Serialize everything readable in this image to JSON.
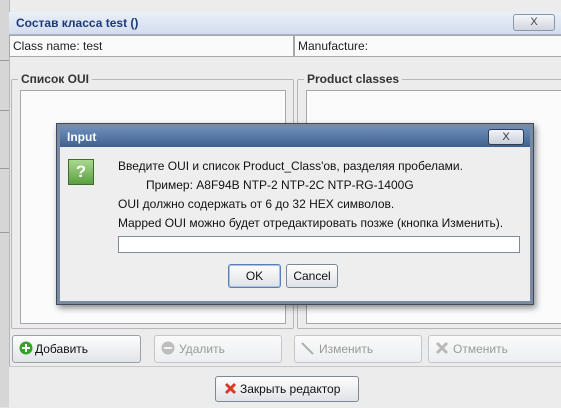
{
  "window": {
    "title": "Состав класса test ()",
    "close_glyph": "X",
    "class_name_label": "Class name: test",
    "manufacture_label": "Manufacture:"
  },
  "groups": {
    "oui_list": "Список OUI",
    "product_classes": "Product classes"
  },
  "toolbar": {
    "add": "Добавить",
    "delete": "Удалить",
    "edit": "Изменить",
    "cancel": "Отменить"
  },
  "footer": {
    "close_editor": "Закрыть редактор"
  },
  "dialog": {
    "title": "Input",
    "close_glyph": "X",
    "line1": "Введите OUI и список Product_Class'ов, разделяя пробелами.",
    "line2": "Пример: A8F94B NTP-2 NTP-2C NTP-RG-1400G",
    "line3": "OUI должно содержать от 6 до 32 HEX символов.",
    "line4": "Mapped OUI можно будет отредактировать позже (кнопка Изменить).",
    "input_value": "",
    "ok": "OK",
    "cancel": "Cancel"
  },
  "colors": {
    "title_text": "#1c3a7a",
    "dialog_title_bg": "#4f6f9f",
    "add_icon": "#3aa02c",
    "close_icon": "#d83a2a"
  },
  "icons": {
    "add": "plus-circle-icon",
    "delete": "minus-circle-icon",
    "edit": "pencil-line-icon",
    "cancel": "x-icon",
    "close_editor": "red-x-icon",
    "dialog": "question-icon"
  }
}
